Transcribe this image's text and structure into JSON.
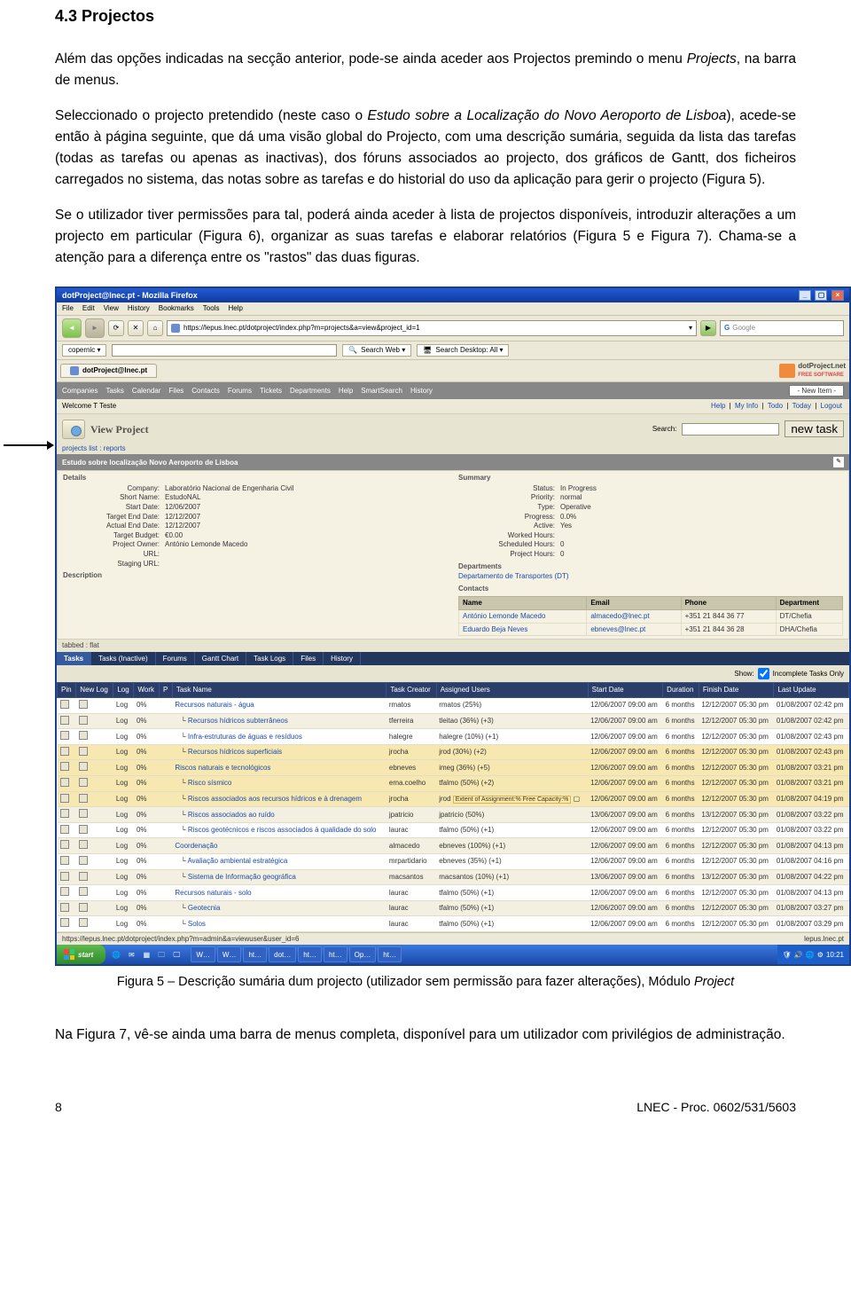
{
  "heading": "4.3   Projectos",
  "para1_a": "Além das opções indicadas na secção anterior, pode-se ainda aceder aos Projectos premindo o menu ",
  "para1_b": "Projects",
  "para1_c": ", na barra de menus.",
  "para2_a": "Seleccionado o projecto pretendido (neste caso o ",
  "para2_b": "Estudo sobre a Localização do Novo Aeroporto de Lisboa",
  "para2_c": "), acede-se então à página seguinte, que dá uma visão global do Projecto, com uma descrição sumária, seguida da lista das tarefas (todas as tarefas ou apenas as inactivas), dos fóruns associados ao projecto, dos gráficos de Gantt, dos ficheiros carregados no sistema, das notas sobre as tarefas e do historial do uso da aplicação para gerir o projecto (Figura 5).",
  "para3": "Se o utilizador tiver permissões para tal, poderá ainda aceder à lista de projectos disponíveis, introduzir alterações a um projecto em particular (Figura 6), organizar as suas tarefas e elaborar relatórios (Figura 5 e Figura 7). Chama-se a atenção para a diferença entre os \"rastos\" das duas figuras.",
  "caption": "Figura 5 – Descrição sumária dum projecto (utilizador sem permissão para fazer alterações), Módulo ",
  "caption_i": "Project",
  "para4": "Na Figura 7, vê-se ainda uma barra de menus completa, disponível para um utilizador com privilégios de administração.",
  "footer_left": "8",
  "footer_right": "LNEC - Proc. 0602/531/5603",
  "shot": {
    "titlebar": "dotProject@lnec.pt - Mozilla Firefox",
    "ffmenu": [
      "File",
      "Edit",
      "View",
      "History",
      "Bookmarks",
      "Tools",
      "Help"
    ],
    "url": "https://lepus.lnec.pt/dotproject/index.php?m=projects&a=view&project_id=1",
    "gsearch_placeholder": "Google",
    "copernic": "copernic ▾",
    "searchweb": "Search Web ▾",
    "searchdesktop": "Search Desktop: All ▾",
    "tab": "dotProject@lnec.pt",
    "dpbrand": "dotProject.net",
    "dpbrand_sub": "FREE SOFTWARE",
    "dpmenu": [
      "Companies",
      "Tasks",
      "Calendar",
      "Files",
      "Contacts",
      "Forums",
      "Tickets",
      "Departments",
      "Help",
      "SmartSearch",
      "History"
    ],
    "newitem": "- New Item -",
    "welcome": "Welcome T Teste",
    "rightlinks": [
      "Help",
      "My Info",
      "Todo",
      "Today",
      "Logout"
    ],
    "viewlabel": "View Project",
    "searchlabel": "Search:",
    "newtask": "new task",
    "sublinks": "projects list : reports",
    "projtab": "Estudo sobre localização Novo Aeroporto de Lisboa",
    "det_hdr_l": "Details",
    "det_hdr_r": "Summary",
    "det_l": [
      [
        "Company:",
        "Laboratório Nacional de Engenharia Civil"
      ],
      [
        "Short Name:",
        "EstudoNAL"
      ],
      [
        "Start Date:",
        "12/06/2007"
      ],
      [
        "Target End Date:",
        "12/12/2007"
      ],
      [
        "Actual End Date:",
        "12/12/2007"
      ],
      [
        "Target Budget:",
        "€0.00"
      ],
      [
        "Project Owner:",
        "António Lemonde Macedo"
      ],
      [
        "URL:",
        ""
      ],
      [
        "Staging URL:",
        ""
      ]
    ],
    "descr_label": "Description",
    "det_r": [
      [
        "Status:",
        "In Progress"
      ],
      [
        "Priority:",
        "normal"
      ],
      [
        "Type:",
        "Operative"
      ],
      [
        "Progress:",
        "0.0%"
      ],
      [
        "Active:",
        "Yes"
      ],
      [
        "Worked Hours:",
        ""
      ],
      [
        "Scheduled Hours:",
        "0"
      ],
      [
        "Project Hours:",
        "0"
      ]
    ],
    "depts_label": "Departments",
    "dept": "Departamento de Transportes (DT)",
    "contacts_label": "Contacts",
    "contacts_hdr": [
      "Name",
      "Email",
      "Phone",
      "Department"
    ],
    "contacts": [
      [
        "António Lemonde Macedo",
        "almacedo@lnec.pt",
        "+351 21 844 36 77",
        "DT/Chefia"
      ],
      [
        "Eduardo Beja Neves",
        "ebneves@lnec.pt",
        "+351 21 844 36 28",
        "DHA/Chefia"
      ]
    ],
    "tabline": "tabbed : flat",
    "tabs": [
      "Tasks",
      "Tasks (Inactive)",
      "Forums",
      "Gantt Chart",
      "Task Logs",
      "Files",
      "History"
    ],
    "showopt": "Show:",
    "chkopt": "Incomplete Tasks Only",
    "task_hdr": [
      "Pin",
      "New Log",
      "Log",
      "Work",
      "P",
      "Task Name",
      "Task Creator",
      "Assigned Users",
      "Start Date",
      "Duration",
      "Finish Date",
      "Last Update"
    ],
    "ext_label": "Extent of Assignment:% Free Capacity:%",
    "tasks": [
      {
        "name": "Recursos naturais - água",
        "creator": "rmatos",
        "assigned": "rmatos (25%)",
        "start": "12/06/2007 09:00 am",
        "dur": "6 months",
        "fin": "12/12/2007 05:30 pm",
        "upd": "01/08/2007 02:42 pm",
        "hl": false,
        "indent": 0
      },
      {
        "name": "Recursos hídricos subterrâneos",
        "creator": "tferreira",
        "assigned": "tleitao (36%) (+3)",
        "start": "12/06/2007 09:00 am",
        "dur": "6 months",
        "fin": "12/12/2007 05:30 pm",
        "upd": "01/08/2007 02:42 pm",
        "hl": false,
        "indent": 1
      },
      {
        "name": "Infra-estruturas de águas e resíduos",
        "creator": "halegre",
        "assigned": "halegre (10%) (+1)",
        "start": "12/06/2007 09:00 am",
        "dur": "6 months",
        "fin": "12/12/2007 05:30 pm",
        "upd": "01/08/2007 02:43 pm",
        "hl": false,
        "indent": 1
      },
      {
        "name": "Recursos hídricos superficiais",
        "creator": "jrocha",
        "assigned": "jrod (30%) (+2)",
        "start": "12/06/2007 09:00 am",
        "dur": "6 months",
        "fin": "12/12/2007 05:30 pm",
        "upd": "01/08/2007 02:43 pm",
        "hl": true,
        "indent": 1
      },
      {
        "name": "Riscos naturais e tecnológicos",
        "creator": "ebneves",
        "assigned": "imeg (36%) (+5)",
        "start": "12/06/2007 09:00 am",
        "dur": "6 months",
        "fin": "12/12/2007 05:30 pm",
        "upd": "01/08/2007 03:21 pm",
        "hl": true,
        "indent": 0
      },
      {
        "name": "Risco sísmico",
        "creator": "ema.coelho",
        "assigned": "tfalmo (50%) (+2)",
        "start": "12/06/2007 09:00 am",
        "dur": "6 months",
        "fin": "12/12/2007 05:30 pm",
        "upd": "01/08/2007 03:21 pm",
        "hl": true,
        "indent": 1
      },
      {
        "name": "Riscos associados aos recursos hídricos e à drenagem",
        "creator": "jrocha",
        "assigned": "jrod",
        "start": "12/06/2007 09:00 am",
        "dur": "6 months",
        "fin": "12/12/2007 05:30 pm",
        "upd": "01/08/2007 04:19 pm",
        "hl": true,
        "indent": 1,
        "ext": true
      },
      {
        "name": "Riscos associados ao ruído",
        "creator": "jpatricio",
        "assigned": "jpatricio (50%)",
        "start": "13/06/2007 09:00 am",
        "dur": "6 months",
        "fin": "13/12/2007 05:30 pm",
        "upd": "01/08/2007 03:22 pm",
        "hl": false,
        "indent": 1
      },
      {
        "name": "Riscos geotécnicos e riscos associados à qualidade do solo",
        "creator": "laurac",
        "assigned": "tfalmo (50%) (+1)",
        "start": "12/06/2007 09:00 am",
        "dur": "6 months",
        "fin": "12/12/2007 05:30 pm",
        "upd": "01/08/2007 03:22 pm",
        "hl": false,
        "indent": 1
      },
      {
        "name": "Coordenação",
        "creator": "almacedo",
        "assigned": "ebneves (100%) (+1)",
        "start": "12/06/2007 09:00 am",
        "dur": "6 months",
        "fin": "12/12/2007 05:30 pm",
        "upd": "01/08/2007 04:13 pm",
        "hl": false,
        "indent": 0
      },
      {
        "name": "Avaliação ambiental estratégica",
        "creator": "mrpartidario",
        "assigned": "ebneves (35%) (+1)",
        "start": "12/06/2007 09:00 am",
        "dur": "6 months",
        "fin": "12/12/2007 05:30 pm",
        "upd": "01/08/2007 04:16 pm",
        "hl": false,
        "indent": 1
      },
      {
        "name": "Sistema de Informação geográfica",
        "creator": "macsantos",
        "assigned": "macsantos (10%) (+1)",
        "start": "13/06/2007 09:00 am",
        "dur": "6 months",
        "fin": "13/12/2007 05:30 pm",
        "upd": "01/08/2007 04:22 pm",
        "hl": false,
        "indent": 1
      },
      {
        "name": "Recursos naturais - solo",
        "creator": "laurac",
        "assigned": "tfalmo (50%) (+1)",
        "start": "12/06/2007 09:00 am",
        "dur": "6 months",
        "fin": "12/12/2007 05:30 pm",
        "upd": "01/08/2007 04:13 pm",
        "hl": false,
        "indent": 0
      },
      {
        "name": "Geotecnia",
        "creator": "laurac",
        "assigned": "tfalmo (50%) (+1)",
        "start": "12/06/2007 09:00 am",
        "dur": "6 months",
        "fin": "12/12/2007 05:30 pm",
        "upd": "01/08/2007 03:27 pm",
        "hl": false,
        "indent": 1
      },
      {
        "name": "Solos",
        "creator": "laurac",
        "assigned": "tfalmo (50%) (+1)",
        "start": "12/06/2007 09:00 am",
        "dur": "6 months",
        "fin": "12/12/2007 05:30 pm",
        "upd": "01/08/2007 03:29 pm",
        "hl": false,
        "indent": 1
      }
    ],
    "status_l": "https://lepus.lnec.pt/dotproject/index.php?m=admin&a=viewuser&user_id=6",
    "status_r": "lepus.lnec.pt",
    "start": "start",
    "tbapps": [
      "W…",
      "W…",
      "ht…",
      "dot…",
      "ht…",
      "ht…",
      "Op…",
      "ht…"
    ],
    "clock": "10:21"
  }
}
